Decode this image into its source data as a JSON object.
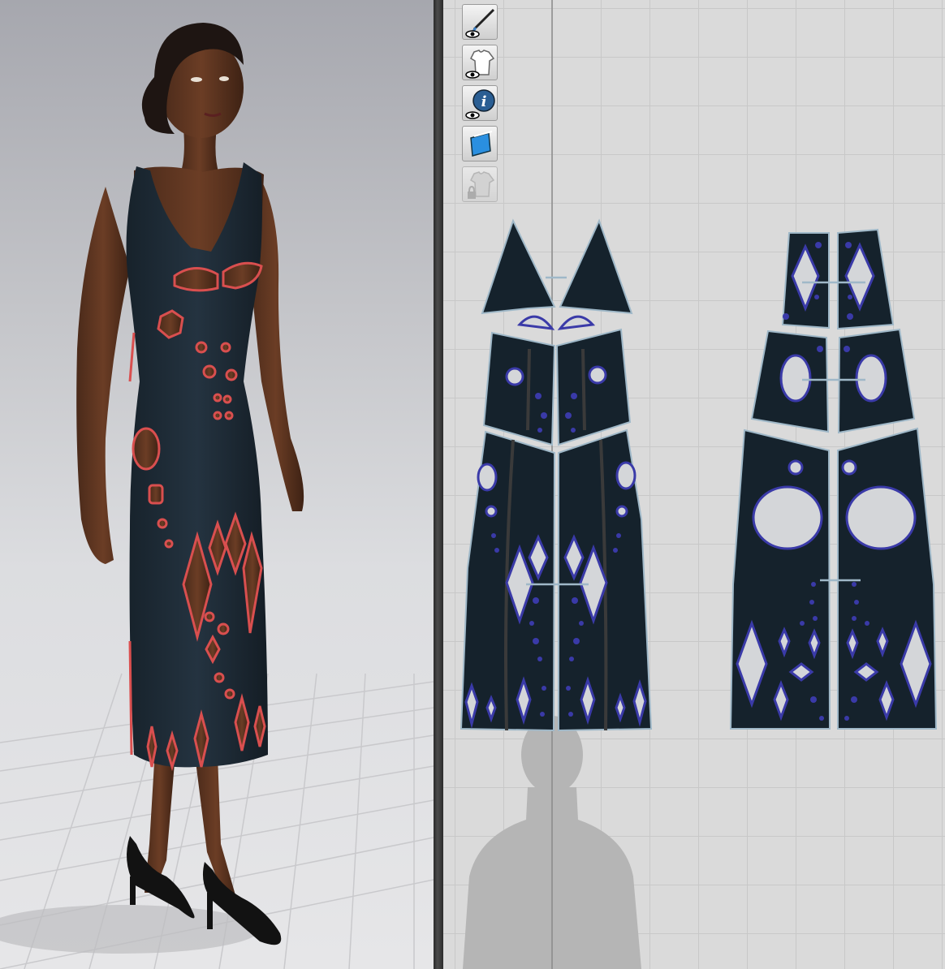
{
  "app": {
    "panels": [
      "3d-garment-window",
      "2d-pattern-window"
    ]
  },
  "toolbar": {
    "tools": [
      {
        "icon": "eye-needle-icon",
        "state": "enabled"
      },
      {
        "icon": "eye-shirt-icon",
        "state": "enabled"
      },
      {
        "icon": "eye-info-icon",
        "state": "enabled"
      },
      {
        "icon": "fabric-swatch-icon",
        "state": "enabled"
      },
      {
        "icon": "locked-shirt-icon",
        "state": "disabled"
      }
    ]
  },
  "colors": {
    "fabric": "#15222c",
    "outline_3d": "#d94f4f",
    "pattern_line": "#3a3aa8",
    "pattern_edge": "#9fb8c8",
    "grid": "#c8c8c8",
    "background_2d": "#dadada"
  }
}
